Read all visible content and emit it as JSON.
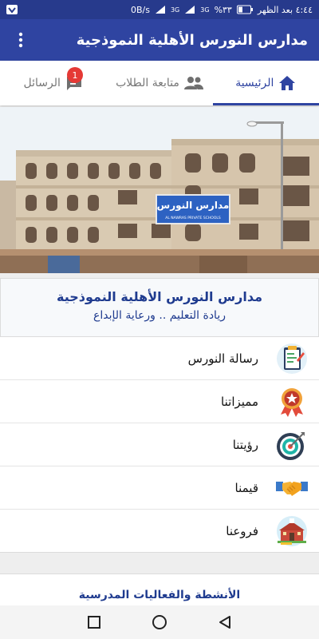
{
  "status_bar": {
    "time": "٤:٤٤ بعد الظهر",
    "battery": "%٣٣",
    "network_1": "3G",
    "network_2": "3G",
    "speed": "0B/s"
  },
  "app_bar": {
    "title": "مدارس النورس الأهلية النموذجية",
    "menu_icon": "more-vert-icon"
  },
  "tabs": [
    {
      "label": "الرئيسية",
      "icon": "home-icon",
      "active": true
    },
    {
      "label": "متابعة الطلاب",
      "icon": "people-icon",
      "active": false
    },
    {
      "label": "الرسائل",
      "icon": "message-icon",
      "active": false,
      "badge": "1"
    }
  ],
  "hero": {
    "sign_text": "مدارس النورس",
    "sign_subtext": "AL NAWRAS PRIVATE SCHOOLS"
  },
  "intro": {
    "name": "مدارس النورس الأهلية النموذجية",
    "tagline": "ريادة التعليم .. ورعاية الإبداع"
  },
  "menu": [
    {
      "label": "رسالة النورس",
      "icon": "clipboard-icon"
    },
    {
      "label": "مميزاتنا",
      "icon": "medal-star-icon"
    },
    {
      "label": "رؤيتنا",
      "icon": "target-icon"
    },
    {
      "label": "قيمنا",
      "icon": "handshake-icon"
    },
    {
      "label": "فروعنا",
      "icon": "school-building-icon"
    }
  ],
  "activities": {
    "title": "الأنشطة والفعاليات المدرسية"
  },
  "colors": {
    "primary": "#2f44a1",
    "status_bar": "#273a8c",
    "badge": "#e53935",
    "heading": "#1f3b8f"
  }
}
